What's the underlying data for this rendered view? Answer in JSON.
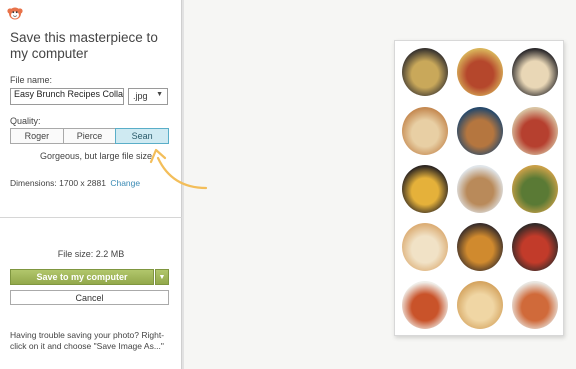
{
  "dialog": {
    "title": "Save this masterpiece to my computer",
    "file_name_label": "File name:",
    "file_name_value": "Easy Brunch Recipes Collage",
    "file_type": ".jpg",
    "quality_label": "Quality:",
    "quality_options": [
      "Roger",
      "Pierce",
      "Sean"
    ],
    "quality_selected": "Sean",
    "quality_description": "Gorgeous, but large file size",
    "dimensions_label": "Dimensions:",
    "dimensions_value": "1700 x 2881",
    "change_link": "Change",
    "file_size": "File size: 2.2 MB",
    "save_button": "Save to my computer",
    "cancel_button": "Cancel",
    "help_text": "Having trouble saving your photo? Right-click on it and choose \"Save Image As...\""
  },
  "icons": {
    "logo": "monkey-logo-icon",
    "dropdown": "chevron-down-icon",
    "arrow": "curved-arrow-icon"
  },
  "colors": {
    "accent_save": "#a2b85a",
    "selected_quality": "#cfeaf2",
    "link": "#3b8bb5",
    "arrow": "#f3be5a",
    "logo": "#e8734a"
  },
  "collage": {
    "photos": [
      {
        "name": "muffin-tin-eggs",
        "bg": "#3a3530",
        "fg": "#c9a85a"
      },
      {
        "name": "egg-casserole",
        "bg": "#d9b35a",
        "fg": "#b5472c"
      },
      {
        "name": "blueberry-pancakes",
        "bg": "#2c2a2c",
        "fg": "#e9d7b6"
      },
      {
        "name": "french-toast-bake",
        "bg": "#c58a52",
        "fg": "#e8cfa4"
      },
      {
        "name": "breakfast-sandwich",
        "bg": "#26496b",
        "fg": "#b5763f"
      },
      {
        "name": "waffle-stack",
        "bg": "#d9c4a3",
        "fg": "#b6402f"
      },
      {
        "name": "skillet-eggs",
        "bg": "#2d2622",
        "fg": "#e5b13a"
      },
      {
        "name": "cinnamon-rolls",
        "bg": "#e1e6ea",
        "fg": "#b98a5a"
      },
      {
        "name": "frittata",
        "bg": "#caa048",
        "fg": "#5a7a35"
      },
      {
        "name": "stuffed-french-toast",
        "bg": "#dcae76",
        "fg": "#f1e2c6"
      },
      {
        "name": "waffle-plate",
        "bg": "#3a2e2a",
        "fg": "#d08a2e"
      },
      {
        "name": "shakshuka-pan",
        "bg": "#332a28",
        "fg": "#c23b2a"
      },
      {
        "name": "eggs-benedict",
        "bg": "#f0efea",
        "fg": "#c9532a"
      },
      {
        "name": "crescent-bake",
        "bg": "#d5a561",
        "fg": "#f0d6a4"
      },
      {
        "name": "breakfast-pizza",
        "bg": "#e9e7e2",
        "fg": "#d06a3a"
      }
    ]
  }
}
